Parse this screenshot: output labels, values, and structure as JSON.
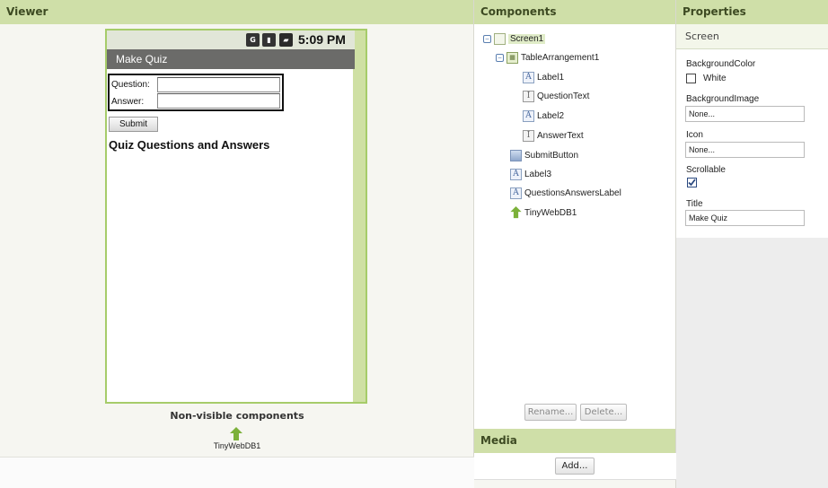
{
  "viewer": {
    "header": "Viewer",
    "phone": {
      "time": "5:09 PM",
      "app_title": "Make Quiz",
      "question_label": "Question:",
      "answer_label": "Answer:",
      "question_value": "",
      "answer_value": "",
      "submit_label": "Submit",
      "qa_label": "Quiz Questions and Answers"
    },
    "nonvisible_title": "Non-visible components",
    "nonvisible_item": "TinyWebDB1"
  },
  "components": {
    "header": "Components",
    "tree": [
      {
        "label": "Screen1",
        "icon": "screen-icon",
        "level": 0,
        "toggle": "⊟",
        "selected": true
      },
      {
        "label": "TableArrangement1",
        "icon": "table-arrangement-icon",
        "level": 1,
        "toggle": "⊟"
      },
      {
        "label": "Label1",
        "icon": "label-icon",
        "level": 2
      },
      {
        "label": "QuestionText",
        "icon": "textbox-icon",
        "level": 2
      },
      {
        "label": "Label2",
        "icon": "label-icon",
        "level": 2
      },
      {
        "label": "AnswerText",
        "icon": "textbox-icon",
        "level": 2
      },
      {
        "label": "SubmitButton",
        "icon": "button-icon",
        "level": 1
      },
      {
        "label": "Label3",
        "icon": "label-icon",
        "level": 1
      },
      {
        "label": "QuestionsAnswersLabel",
        "icon": "label-icon",
        "level": 1
      },
      {
        "label": "TinyWebDB1",
        "icon": "tinywebdb-icon",
        "level": 1
      }
    ],
    "rename_label": "Rename...",
    "delete_label": "Delete..."
  },
  "media": {
    "header": "Media",
    "add_label": "Add..."
  },
  "properties": {
    "header": "Properties",
    "component": "Screen",
    "background_color_label": "BackgroundColor",
    "background_color_value": "White",
    "background_image_label": "BackgroundImage",
    "background_image_value": "None...",
    "icon_label": "Icon",
    "icon_value": "None...",
    "scrollable_label": "Scrollable",
    "scrollable_checked": true,
    "title_label": "Title",
    "title_value": "Make Quiz"
  },
  "colors": {
    "header_bg": "#cfdfa8",
    "phone_border": "#a6cc6a",
    "titlebar_bg": "#6b6b69"
  }
}
